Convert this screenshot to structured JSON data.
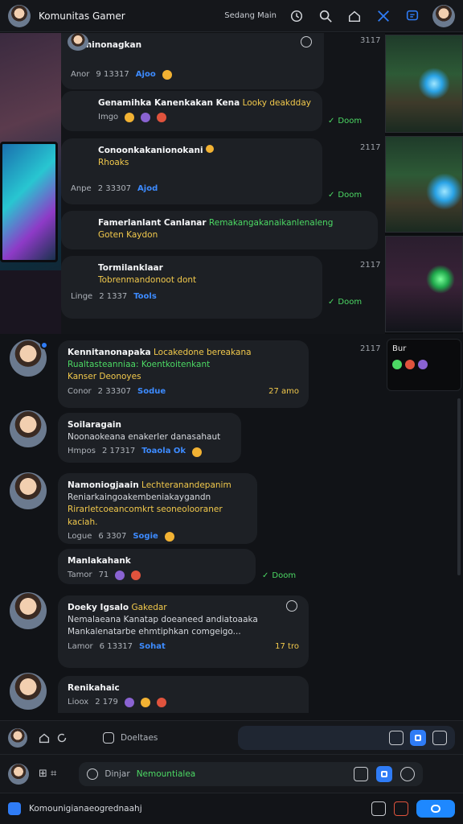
{
  "app": {
    "title": "Komunitas Gamer",
    "status": "Sedang Main"
  },
  "messages": [
    {
      "name": "Kaminonagkan",
      "body": "",
      "meta_left": "Anor",
      "meta_num": "9 13317",
      "meta_blue": "Ajoo",
      "time": "3117"
    },
    {
      "name": "Genamihka Kanenkakan Kena",
      "name_tail": "Looky deakdday",
      "meta_left": "Imgo",
      "status": "Doom"
    },
    {
      "name": "Conoonkakanionokani",
      "line2": "Rhoaks",
      "meta_left": "Anpe",
      "meta_num": "2 33307",
      "meta_blue": "Ajod",
      "time": "2117",
      "status": "Doom"
    },
    {
      "name": "Famerlanlant Canlanar",
      "green": "Remakangakanaikanlenaleng",
      "line2": "Goten Kaydon",
      "status": ""
    },
    {
      "name": "Tormilanklaar",
      "line2": "Tobrenmandonoot dont",
      "meta_left": "Linge",
      "meta_num": "2 1337",
      "meta_blue": "Tools",
      "time": "2117",
      "status": "Doom"
    },
    {
      "name": "Kennitanonapaka",
      "yellow": "Locakedone bereakana",
      "green": "Rualtasteanniaa: Koentkoitenkant",
      "line2": "Kanser Deonoyes",
      "meta_left": "Conor",
      "meta_num": "2 33307",
      "meta_blue": "Sodue",
      "meta_yel": "27 amo",
      "time": "2117"
    },
    {
      "name": "Soilaragain",
      "body": "Noonaokeana enakerler danasahaut",
      "meta_left": "Hmpos",
      "meta_num": "2 17317",
      "meta_blue": "Toaola Ok"
    },
    {
      "name": "Namoniogjaain",
      "yellow": "Lechteranandepanim",
      "body": "Reniarkaingoakembeniakaygandn",
      "yellow2": "Rirarletcoeancomkrt seoneolooraner kaciah.",
      "meta_left": "Logue",
      "meta_num": "6 3307",
      "meta_blue": "Sogie"
    },
    {
      "name": "Manlakahank",
      "meta_left": "Tamor",
      "meta_num": "71",
      "status": "Doom"
    },
    {
      "name": "Doeky Igsalo",
      "yellow": "Gakedar",
      "body": "Nemalaeana Kanatap doeaneed andiatoaaka",
      "body2": "Mankalenatarbe ehmtiphkan comgeigo...",
      "meta_left": "Lamor",
      "meta_num": "6 13317",
      "meta_blue": "Sohat",
      "meta_yel": "17 tro"
    },
    {
      "name": "Renikahaic",
      "meta_left": "Lioox",
      "meta_num": "2 179"
    }
  ],
  "mini_panel": {
    "title": "Bur"
  },
  "bars": {
    "bar1_placeholder": "Doeltaes",
    "bar2_placeholder": "Dinjar",
    "bar2_green": "Nemountialea",
    "bar3_text": "Komounigianaeogrednaahj"
  },
  "colors": {
    "accent": "#2f7cf6",
    "green": "#4cd964",
    "yellow": "#f2c94c"
  }
}
